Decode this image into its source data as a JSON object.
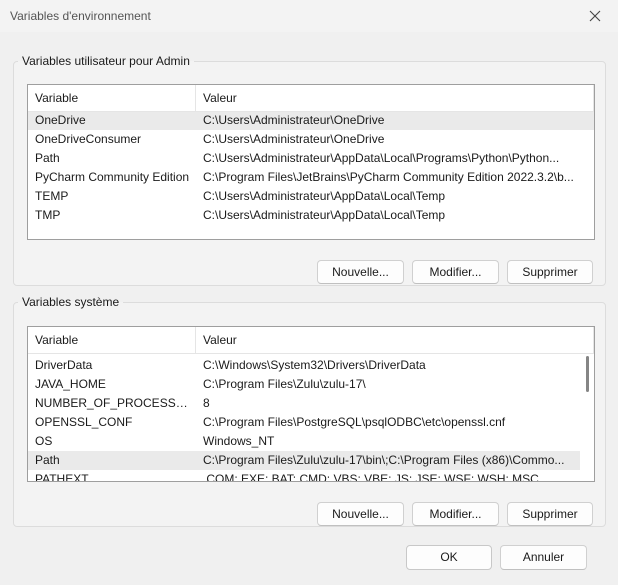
{
  "window": {
    "title": "Variables d'environnement",
    "close_icon": "close-icon"
  },
  "user_group": {
    "legend": "Variables utilisateur pour Admin",
    "columns": [
      "Variable",
      "Valeur"
    ],
    "rows": [
      {
        "variable": "OneDrive",
        "value": "C:\\Users\\Administrateur\\OneDrive",
        "selected": true
      },
      {
        "variable": "OneDriveConsumer",
        "value": "C:\\Users\\Administrateur\\OneDrive"
      },
      {
        "variable": "Path",
        "value": "C:\\Users\\Administrateur\\AppData\\Local\\Programs\\Python\\Python..."
      },
      {
        "variable": "PyCharm Community Edition",
        "value": "C:\\Program Files\\JetBrains\\PyCharm Community Edition 2022.3.2\\b..."
      },
      {
        "variable": "TEMP",
        "value": "C:\\Users\\Administrateur\\AppData\\Local\\Temp"
      },
      {
        "variable": "TMP",
        "value": "C:\\Users\\Administrateur\\AppData\\Local\\Temp"
      }
    ],
    "buttons": {
      "new": "Nouvelle...",
      "edit": "Modifier...",
      "delete": "Supprimer"
    }
  },
  "system_group": {
    "legend": "Variables système",
    "columns": [
      "Variable",
      "Valeur"
    ],
    "rows": [
      {
        "variable": "DriverData",
        "value": "C:\\Windows\\System32\\Drivers\\DriverData"
      },
      {
        "variable": "JAVA_HOME",
        "value": "C:\\Program Files\\Zulu\\zulu-17\\"
      },
      {
        "variable": "NUMBER_OF_PROCESSORS",
        "value": "8"
      },
      {
        "variable": "OPENSSL_CONF",
        "value": "C:\\Program Files\\PostgreSQL\\psqlODBC\\etc\\openssl.cnf"
      },
      {
        "variable": "OS",
        "value": "Windows_NT"
      },
      {
        "variable": "Path",
        "value": "C:\\Program Files\\Zulu\\zulu-17\\bin\\;C:\\Program Files (x86)\\Commo...",
        "selected": true
      },
      {
        "variable": "PATHEXT",
        "value": ".COM;.EXE;.BAT;.CMD;.VBS;.VBE;.JS;.JSE;.WSF;.WSH;.MSC"
      }
    ],
    "buttons": {
      "new": "Nouvelle...",
      "edit": "Modifier...",
      "delete": "Supprimer"
    }
  },
  "footer": {
    "ok": "OK",
    "cancel": "Annuler"
  },
  "colors": {
    "selected_row": "#eaeaea",
    "window_bg": "#f0f0f0",
    "list_border": "#9e9e9e"
  }
}
